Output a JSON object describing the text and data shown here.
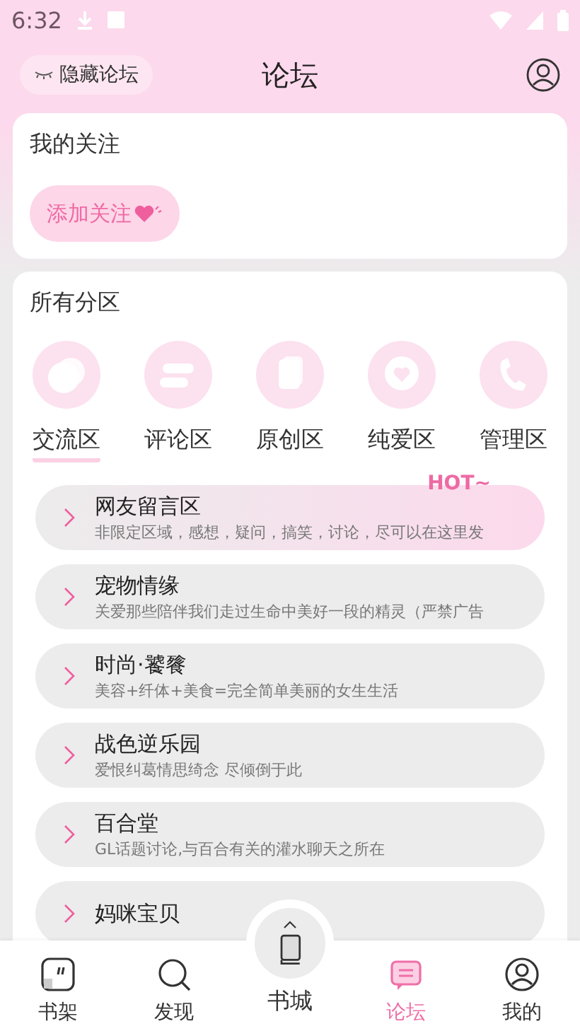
{
  "status_bar": {
    "time": "6:32"
  },
  "header": {
    "hide_button": "隐藏论坛",
    "title": "论坛"
  },
  "following": {
    "title": "我的关注",
    "add_button": "添加关注"
  },
  "sections": {
    "title": "所有分区",
    "categories": [
      {
        "label": "交流区",
        "kind": "chat",
        "selected": true
      },
      {
        "label": "评论区",
        "kind": "comment",
        "selected": false
      },
      {
        "label": "原创区",
        "kind": "pages",
        "selected": false
      },
      {
        "label": "纯爱区",
        "kind": "heart",
        "selected": false
      },
      {
        "label": "管理区",
        "kind": "phone",
        "selected": false
      }
    ],
    "forums": [
      {
        "name": "网友留言区",
        "description": "非限定区域，感想，疑问，搞笑，讨论，尽可以在这里发",
        "badge": "HOT~"
      },
      {
        "name": "宠物情缘",
        "description": "关爱那些陪伴我们走过生命中美好一段的精灵（严禁广告"
      },
      {
        "name": "时尚·饕餮",
        "description": "美容+纤体+美食=完全简单美丽的女生生活"
      },
      {
        "name": "战色逆乐园",
        "description": "爱恨纠葛情思绮念 尽倾倒于此"
      },
      {
        "name": "百合堂",
        "description": "GL话题讨论,与百合有关的灌水聊天之所在"
      },
      {
        "name": "妈咪宝贝"
      }
    ]
  },
  "bottom_nav": [
    {
      "label": "书架",
      "kind": "shelf",
      "selected": false
    },
    {
      "label": "发现",
      "kind": "discover",
      "selected": false
    },
    {
      "label": "书城",
      "kind": "store",
      "selected": false
    },
    {
      "label": "论坛",
      "kind": "forum",
      "selected": true
    },
    {
      "label": "我的",
      "kind": "mine",
      "selected": false
    }
  ]
}
